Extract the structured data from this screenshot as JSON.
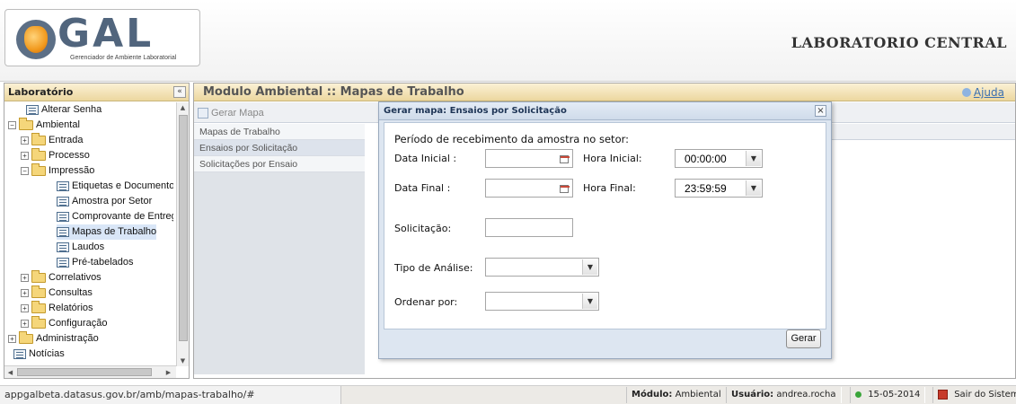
{
  "header": {
    "logo_text": "GAL",
    "logo_subtitle": "Gerenciador de Ambiente Laboratorial",
    "title": "LABORATORIO CENTRAL"
  },
  "sidebar": {
    "title": "Laboratório",
    "collapse_label": "«",
    "tree": [
      {
        "label": "Alterar Senha",
        "type": "page",
        "level": 1
      },
      {
        "label": "Ambiental",
        "type": "folder",
        "level": 0,
        "expanded": true
      },
      {
        "label": "Entrada",
        "type": "folder",
        "level": 1,
        "expanded": false
      },
      {
        "label": "Processo",
        "type": "folder",
        "level": 1,
        "expanded": false
      },
      {
        "label": "Impressão",
        "type": "folder",
        "level": 1,
        "expanded": true
      },
      {
        "label": "Etiquetas e Documentos",
        "type": "page",
        "level": 2
      },
      {
        "label": "Amostra por Setor",
        "type": "page",
        "level": 2
      },
      {
        "label": "Comprovante de Entrega",
        "type": "page",
        "level": 2
      },
      {
        "label": "Mapas de Trabalho",
        "type": "page",
        "level": 2,
        "selected": true
      },
      {
        "label": "Laudos",
        "type": "page",
        "level": 2
      },
      {
        "label": "Pré-tabelados",
        "type": "page",
        "level": 2
      },
      {
        "label": "Correlativos",
        "type": "folder",
        "level": 1,
        "expanded": false
      },
      {
        "label": "Consultas",
        "type": "folder",
        "level": 1,
        "expanded": false
      },
      {
        "label": "Relatórios",
        "type": "folder",
        "level": 1,
        "expanded": false
      },
      {
        "label": "Configuração",
        "type": "folder",
        "level": 1,
        "expanded": false
      },
      {
        "label": "Administração",
        "type": "folder",
        "level": 0,
        "expanded": false
      },
      {
        "label": "Notícias",
        "type": "page",
        "level": 0
      }
    ]
  },
  "main": {
    "title": "Modulo Ambiental :: Mapas de Trabalho",
    "help_label": "Ajuda",
    "toolbar": {
      "gerar_mapa_label": "Gerar Mapa"
    },
    "grid_rows": [
      {
        "label": "Mapas de Trabalho",
        "selected": false
      },
      {
        "label": "Ensaios por Solicitação",
        "selected": true
      },
      {
        "label": "Solicitações por Ensaio",
        "selected": false
      }
    ]
  },
  "dialog": {
    "title": "Gerar mapa: Ensaios por Solicitação",
    "close_label": "×",
    "period_label": "Período de recebimento da amostra no setor:",
    "data_inicial_label": "Data Inicial :",
    "data_inicial_value": "",
    "hora_inicial_label": "Hora Inicial:",
    "hora_inicial_value": "00:00:00",
    "data_final_label": "Data Final :",
    "data_final_value": "",
    "hora_final_label": "Hora Final:",
    "hora_final_value": "23:59:59",
    "solicitacao_label": "Solicitação:",
    "solicitacao_value": "",
    "tipo_analise_label": "Tipo de Análise:",
    "tipo_analise_value": "",
    "ordenar_label": "Ordenar por:",
    "ordenar_value": "",
    "gerar_label": "Gerar"
  },
  "statusbar": {
    "url": "appgalbeta.datasus.gov.br/amb/mapas-trabalho/#",
    "modulo_label": "Módulo:",
    "modulo_value": "Ambiental",
    "usuario_label": "Usuário:",
    "usuario_value": "andrea.rocha",
    "date": "15-05-2014",
    "exit_label": "Sair do Sistema"
  },
  "colors": {
    "panel_header": "#ecd79f",
    "dialog_bg": "#dde6f1",
    "link": "#3a6fb0",
    "status_ok": "#3aa53a",
    "exit": "#c73a2a"
  }
}
